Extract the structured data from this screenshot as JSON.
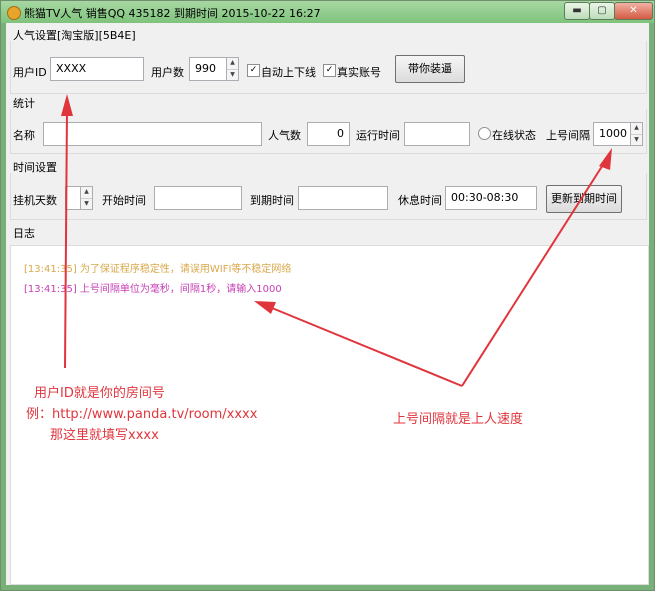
{
  "window": {
    "title": "熊猫TV人气 销售QQ 435182 到期时间 2015-10-22 16:27",
    "min_label": "▬",
    "max_label": "▢",
    "close_label": "✕"
  },
  "popularity": {
    "group_label": "人气设置[淘宝版][5B4E]",
    "user_id_label": "用户ID",
    "user_id_value": "XXXX",
    "user_count_label": "用户数",
    "user_count_value": "990",
    "auto_online_label": "自动上下线",
    "auto_online_checked": true,
    "real_account_label": "真实账号",
    "real_account_checked": true,
    "costume_button": "带你装逼"
  },
  "stats": {
    "group_label": "统计",
    "name_label": "名称",
    "name_value": "",
    "popularity_label": "人气数",
    "popularity_value": "0",
    "runtime_label": "运行时间",
    "runtime_value": "",
    "online_status_label": "在线状态",
    "online_interval_label": "上号间隔",
    "online_interval_value": "1000"
  },
  "time": {
    "group_label": "时间设置",
    "days_label": "挂机天数",
    "days_value": "",
    "start_label": "开始时间",
    "start_value": "",
    "expire_label": "到期时间",
    "expire_value": "",
    "rest_label": "休息时间",
    "rest_value": "00:30-08:30",
    "update_button": "更新到期时间"
  },
  "log": {
    "group_label": "日志",
    "lines": [
      {
        "text": "[13:41:35] 为了保证程序稳定性，请误用WIFI等不稳定网络",
        "color": "#d9a84a"
      },
      {
        "text": "[13:41:35] 上号间隔单位为毫秒，间隔1秒，请输入1000",
        "color": "#c63fb6"
      }
    ]
  },
  "annotations": {
    "note_left": [
      "用户ID就是你的房间号",
      "例：http://www.panda.tv/room/xxxx",
      "那这里就填写xxxx"
    ],
    "note_right": "上号间隔就是上人速度",
    "color": "#e0353d"
  }
}
